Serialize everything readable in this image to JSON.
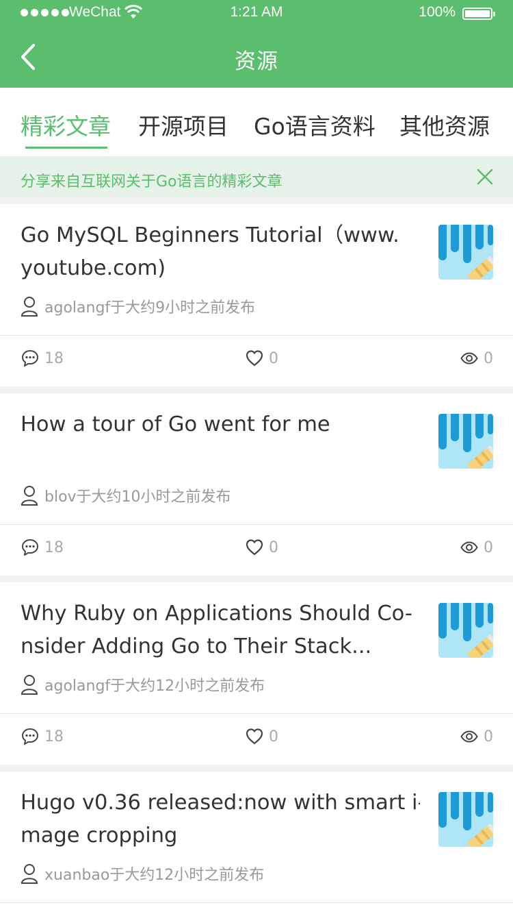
{
  "status_bar": {
    "carrier": "WeChat",
    "time": "1:21 AM",
    "battery": "100%"
  },
  "nav": {
    "title": "资源"
  },
  "tabs": [
    {
      "label": "精彩文章",
      "active": true
    },
    {
      "label": "开源项目",
      "active": false
    },
    {
      "label": "Go语言资料",
      "active": false
    },
    {
      "label": "其他资源",
      "active": false
    }
  ],
  "notice": {
    "text": "分享来自互联网关于Go语言的精彩文章"
  },
  "articles": [
    {
      "title_line1": "Go MySQL Beginners Tutorial（www.",
      "title_line2": "youtube.com)",
      "author_text": "agolangf于大约9小时之前发布",
      "comments": "18",
      "likes": "0",
      "views": "0"
    },
    {
      "title_line1": "How a tour of Go went for me",
      "title_line2": "",
      "author_text": "blov于大约10小时之前发布",
      "comments": "18",
      "likes": "0",
      "views": "0"
    },
    {
      "title_line1": "Why Ruby on Applications Should Co-",
      "title_line2": "nsider Adding Go to Their Stack...",
      "author_text": "agolangf于大约12小时之前发布",
      "comments": "18",
      "likes": "0",
      "views": "0"
    },
    {
      "title_line1": "Hugo v0.36 released:now with smart i-",
      "title_line2": "mage cropping",
      "author_text": "xuanbao于大约12小时之前发布",
      "comments": "",
      "likes": "",
      "views": ""
    }
  ],
  "colors": {
    "brand_green": "#5bbd6e",
    "notice_bg": "#e6f2e8",
    "text_primary": "#333333",
    "text_secondary": "#999999"
  },
  "icons": {
    "back": "chevron-left-icon",
    "close": "close-icon",
    "author": "person-icon",
    "comments": "comment-bubble-icon",
    "likes": "heart-icon",
    "views": "eye-icon"
  }
}
